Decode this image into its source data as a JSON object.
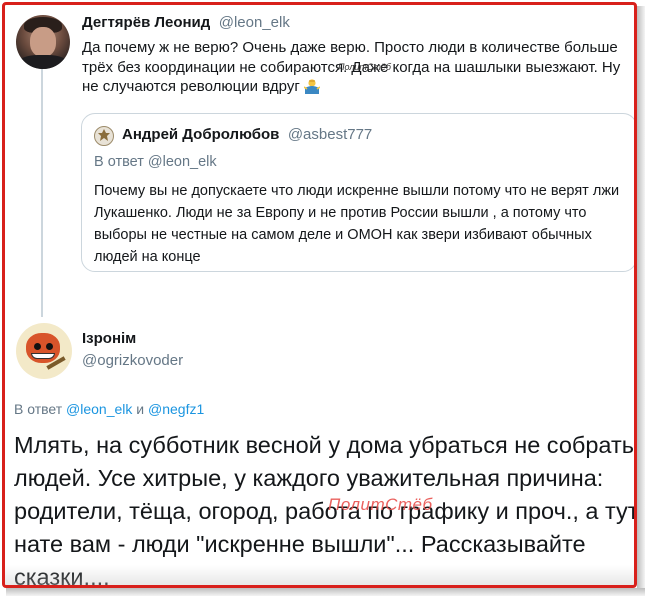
{
  "tweet1": {
    "name": "Дегтярёв Леонид",
    "handle": "@leon_elk",
    "text": "Да почему ж не верю? Очень даже верю. Просто люди в количестве больше трёх без координации не собираются. Даже когда на шашлыки выезжают. Ну не случаются революции вдруг",
    "emoji": "man-shrugging-emoji"
  },
  "quote": {
    "name": "Андрей Добролюбов",
    "handle": "@asbest777",
    "reply_to": "В ответ @leon_elk",
    "text": "Почему вы не допускаете что люди искренне вышли потому что не верят лжи Лукашенко. Люди не за Европу и не против России вышли , а потому что выборы не честные на самом деле и ОМОН как звери избивают обычных людей на конце"
  },
  "tweet2": {
    "name": "Ізронім",
    "handle": "@ogrizkovoder",
    "reply_prefix": "В ответ",
    "reply_handle_1": "@leon_elk",
    "reply_and": "и",
    "reply_handle_2": "@negfz1",
    "text": "Млять, на субботник весной у дома убраться не собрать людей. Усе хитрые, у каждого уважительная причина: родители, тёща, огород, работа по графику и проч., а тут нате вам - люди \"искренне вышли\"... Рассказывайте сказки...."
  },
  "watermark": "ПолитСтёб",
  "colors": {
    "frame": "#d8201b",
    "link": "#1b95e0",
    "muted": "#657786",
    "text": "#14171a"
  }
}
